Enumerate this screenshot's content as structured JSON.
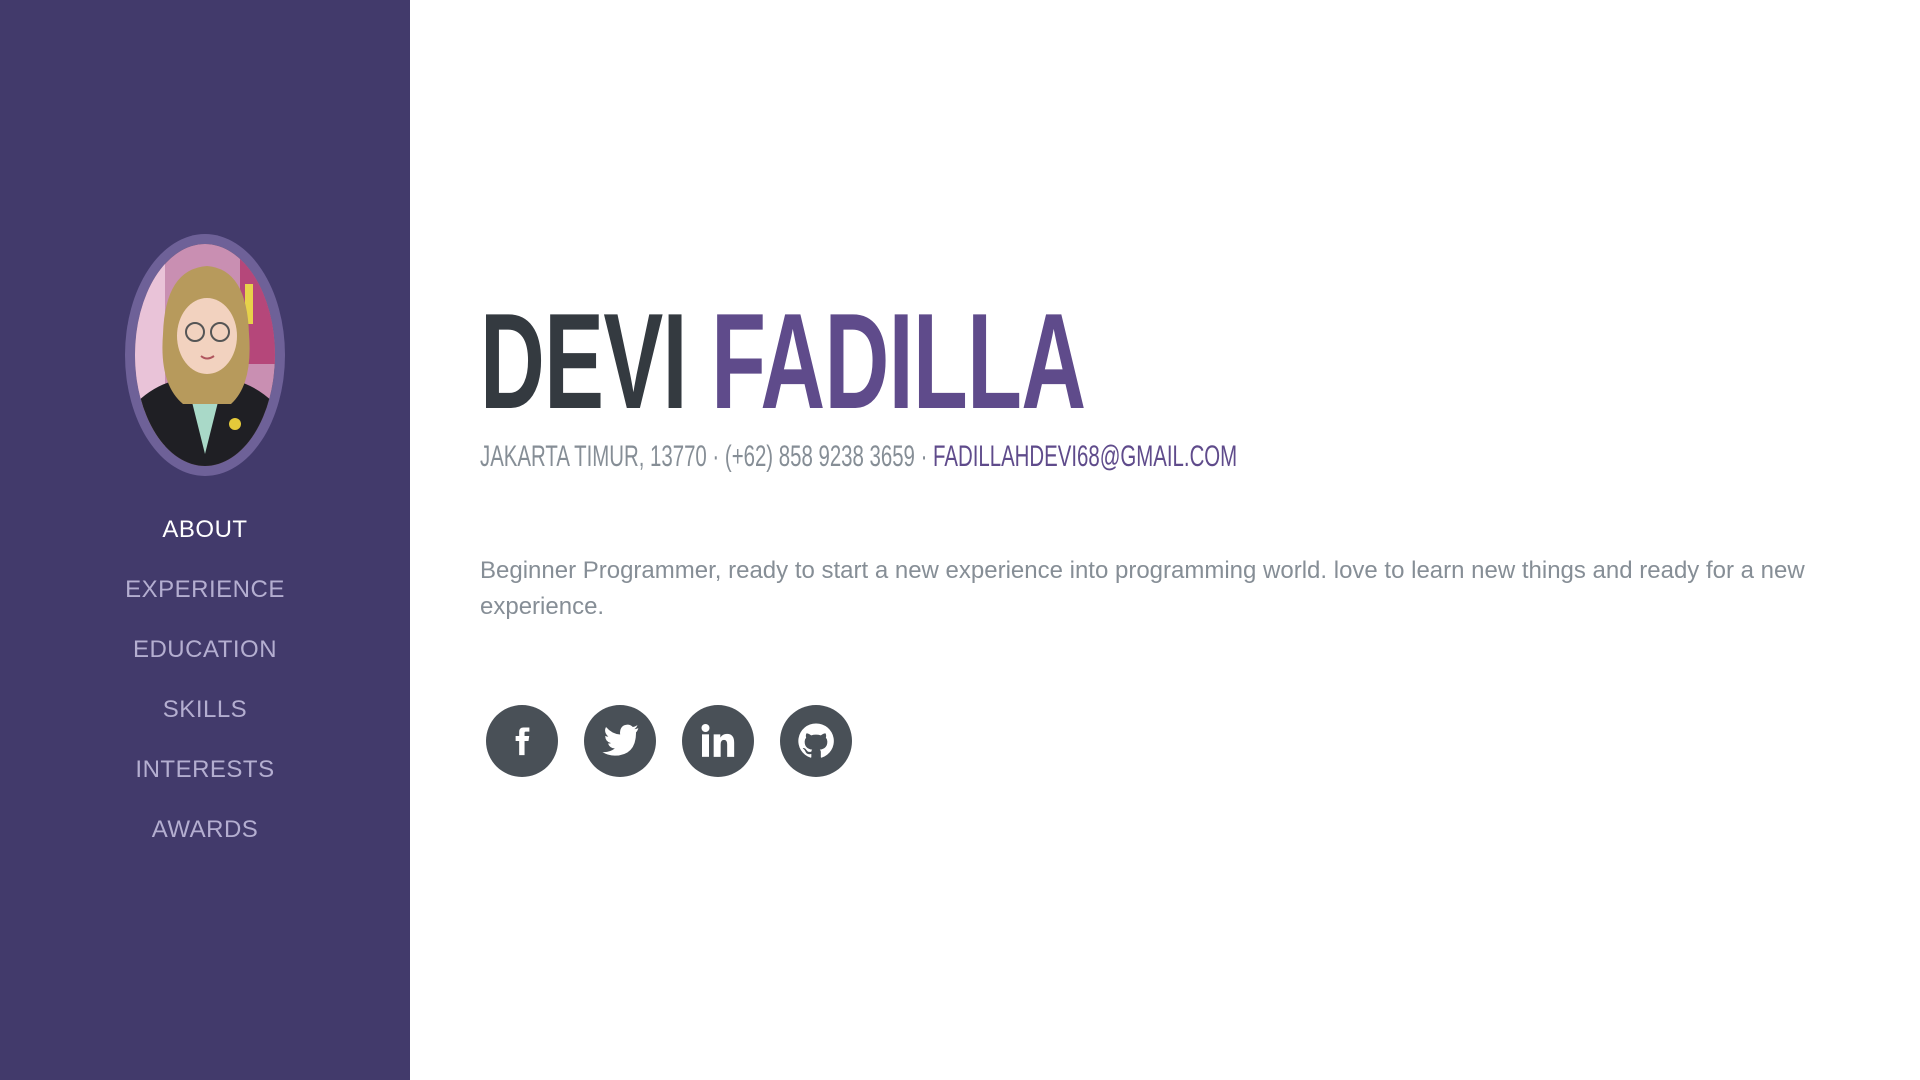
{
  "profile": {
    "first_name": "DEVI",
    "last_name": "FADILLA",
    "address": "JAKARTA TIMUR, 13770",
    "separator": " · ",
    "phone": "(+62) 858 9238 3659",
    "email": "FADILLAHDEVI68@GMAIL.COM",
    "bio": "Beginner Programmer, ready to start a new experience into programming world. love to learn new things and ready for a new experience."
  },
  "nav": {
    "items": [
      {
        "label": "ABOUT",
        "active": true
      },
      {
        "label": "EXPERIENCE",
        "active": false
      },
      {
        "label": "EDUCATION",
        "active": false
      },
      {
        "label": "SKILLS",
        "active": false
      },
      {
        "label": "INTERESTS",
        "active": false
      },
      {
        "label": "AWARDS",
        "active": false
      }
    ]
  },
  "socials": [
    {
      "icon": "facebook-icon"
    },
    {
      "icon": "twitter-icon"
    },
    {
      "icon": "linkedin-icon"
    },
    {
      "icon": "github-icon"
    }
  ],
  "colors": {
    "sidebar": "#423a6b",
    "accent": "#5f4b8b",
    "heading": "#343a40",
    "muted": "#868e96",
    "social_bg": "#495057"
  }
}
